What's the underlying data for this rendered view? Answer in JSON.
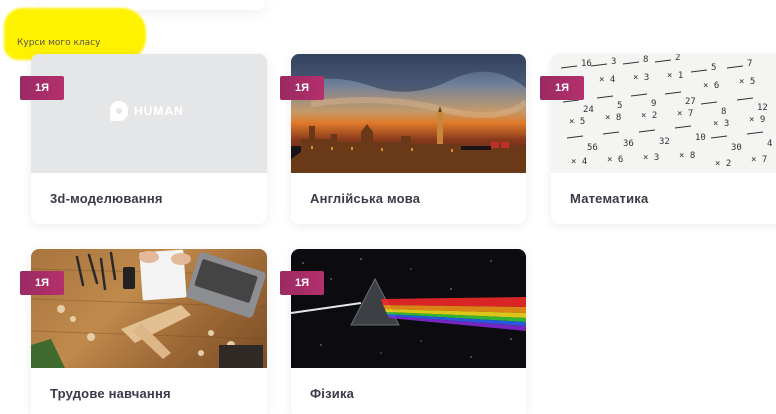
{
  "section": {
    "title": "Курси мого класу",
    "highlight_color": "#fff200"
  },
  "badge_color": "#a02d66",
  "courses": [
    {
      "name": "3d-моделювання",
      "badge": "1Я",
      "logo_text": "HUMAN"
    },
    {
      "name": "Англійська мова",
      "badge": "1Я"
    },
    {
      "name": "Математика",
      "badge": "1Я"
    },
    {
      "name": "Трудове навчання",
      "badge": "1Я"
    },
    {
      "name": "Фізика",
      "badge": "1Я"
    }
  ]
}
